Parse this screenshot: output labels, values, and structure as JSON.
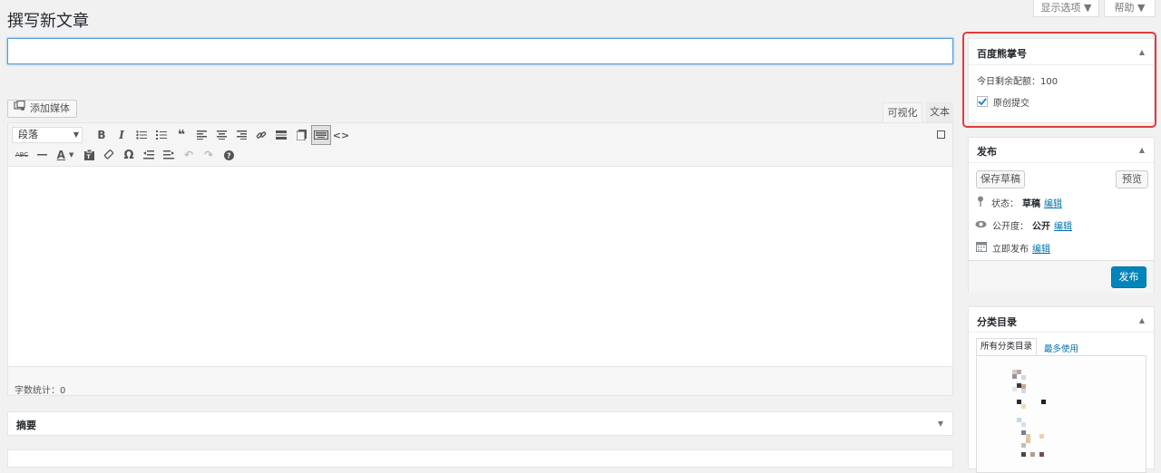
{
  "header": {
    "page_title": "撰写新文章",
    "screen_options_label": "显示选项 ▼",
    "help_label": "帮助 ▼"
  },
  "title_field": {
    "value": "",
    "placeholder": ""
  },
  "editor": {
    "add_media_label": "添加媒体",
    "tabs": {
      "visual": "可视化",
      "text": "文本"
    },
    "format_select": "段落",
    "word_count": "字数统计：0"
  },
  "excerpt_box": {
    "title": "摘要"
  },
  "xiongzhang_box": {
    "title": "百度熊掌号",
    "quota_text": "今日剩余配额：100",
    "original_label": "原创提交",
    "original_checked": true
  },
  "publish_box": {
    "title": "发布",
    "save_draft": "保存草稿",
    "preview": "预览",
    "status_label": "状态：",
    "status_value": "草稿",
    "visibility_label": "公开度：",
    "visibility_value": "公开",
    "schedule_label": "立即发布",
    "edit_link": "编辑",
    "publish_button": "发布"
  },
  "category_box": {
    "title": "分类目录",
    "tab_all": "所有分类目录",
    "tab_most_used": "最多使用"
  },
  "colors": {
    "primary_button": "#0085ba",
    "link": "#0073aa",
    "highlight_border": "#e23b3b",
    "page_bg": "#f1f1f1"
  }
}
